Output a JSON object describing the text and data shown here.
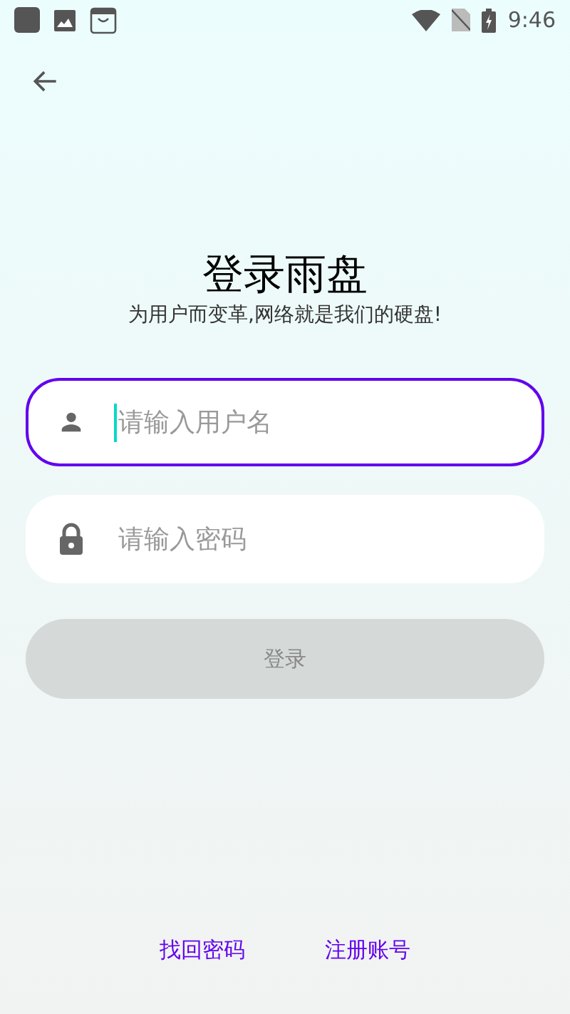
{
  "status_bar": {
    "time": "9:46"
  },
  "title": "登录雨盘",
  "subtitle": "为用户而变革,网络就是我们的硬盘!",
  "fields": [
    {
      "kind": "user",
      "placeholder": "请输入用户名",
      "focused": true
    },
    {
      "kind": "password",
      "placeholder": "请输入密码",
      "focused": false
    }
  ],
  "login_button": {
    "label": "登录",
    "disabled": true
  },
  "links": [
    "找回密码",
    "注册账号"
  ]
}
